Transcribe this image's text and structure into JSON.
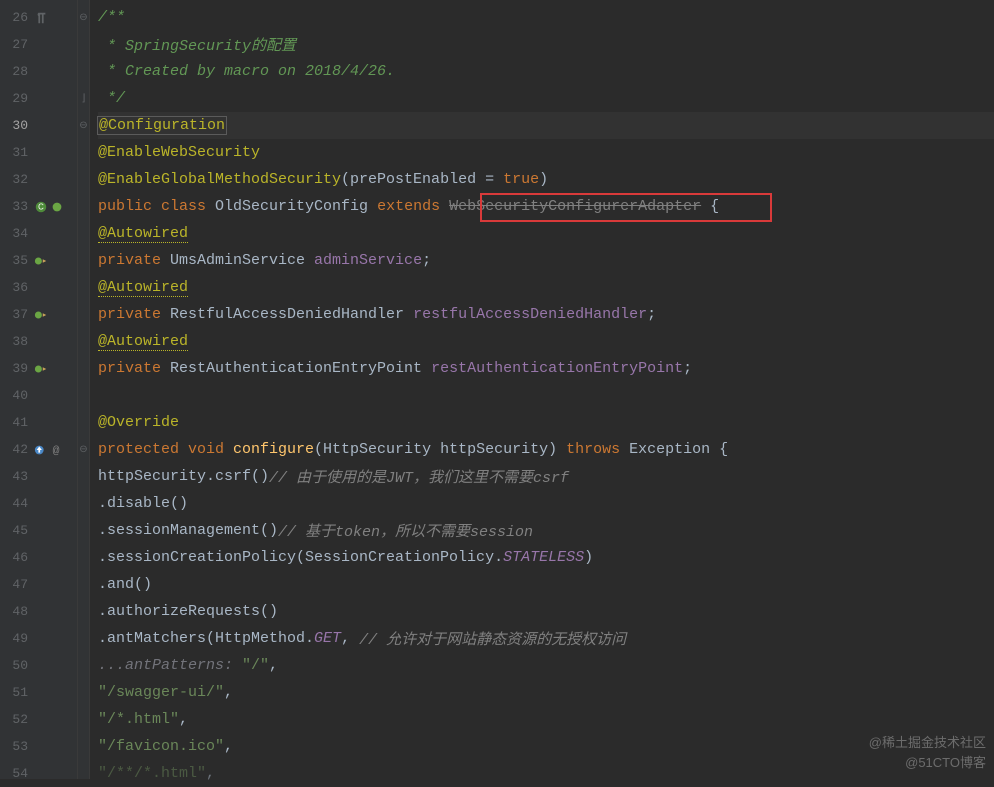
{
  "gutter": {
    "start": 26,
    "end": 54,
    "current": 30,
    "icons": {
      "26": [
        "paragraph"
      ],
      "33": [
        "class-bean"
      ],
      "35": [
        "bean-arrow"
      ],
      "37": [
        "bean-arrow"
      ],
      "39": [
        "bean-arrow"
      ],
      "42": [
        "override",
        "at"
      ]
    },
    "folds": {
      "26": "minus",
      "29": "close",
      "30": "minus",
      "42": "minus"
    }
  },
  "code": {
    "l26": {
      "doc": "/**"
    },
    "l27": {
      "doc": " * SpringSecurity的配置"
    },
    "l28": {
      "doc": " * Created by macro on 2018/4/26."
    },
    "l29": {
      "doc": " */"
    },
    "l30": {
      "annot": "@Configuration"
    },
    "l31": {
      "annot": "@EnableWebSecurity"
    },
    "l32": {
      "annot": "@EnableGlobalMethodSecurity",
      "p": "(prePostEnabled = ",
      "kw": "true",
      "p2": ")"
    },
    "l33": {
      "kw1": "public ",
      "kw2": "class ",
      "cls": "OldSecurityConfig ",
      "kw3": "extends ",
      "dep": "WebSecurityConfigurerAdapter",
      "p": " {"
    },
    "l34": {
      "annot": "@Autowired"
    },
    "l35": {
      "kw": "private ",
      "type": "UmsAdminService ",
      "field": "adminService",
      "p": ";"
    },
    "l36": {
      "annot": "@Autowired"
    },
    "l37": {
      "kw": "private ",
      "type": "RestfulAccessDeniedHandler ",
      "field": "restfulAccessDeniedHandler",
      "p": ";"
    },
    "l38": {
      "annot": "@Autowired"
    },
    "l39": {
      "kw": "private ",
      "type": "RestAuthenticationEntryPoint ",
      "field": "restAuthenticationEntryPoint",
      "p": ";"
    },
    "l41": {
      "annot": "@Override"
    },
    "l42": {
      "kw1": "protected ",
      "kw2": "void ",
      "m": "configure",
      "p1": "(HttpSecurity httpSecurity) ",
      "kw3": "throws ",
      "ex": "Exception {"
    },
    "l43": {
      "obj": "httpSecurity.csrf()",
      "cm": "// 由于使用的是JWT，我们这里不需要csrf"
    },
    "l44": {
      "m": ".disable()"
    },
    "l45": {
      "m": ".sessionManagement()",
      "cm": "// 基于token，所以不需要session"
    },
    "l46": {
      "m": ".sessionCreationPolicy(SessionCreationPolicy.",
      "s": "STATELESS",
      "p": ")"
    },
    "l47": {
      "m": ".and()"
    },
    "l48": {
      "m": ".authorizeRequests()"
    },
    "l49": {
      "m": ".antMatchers(HttpMethod.",
      "s": "GET",
      "p": ", ",
      "cm": "// 允许对于网站静态资源的无授权访问"
    },
    "l50": {
      "pn": "...antPatterns: ",
      "str": "\"/\"",
      "p": ","
    },
    "l51": {
      "str": "\"/swagger-ui/\"",
      "p": ","
    },
    "l52": {
      "str": "\"/*.html\"",
      "p": ","
    },
    "l53": {
      "str": "\"/favicon.ico\"",
      "p": ","
    },
    "l54": {
      "str": "\"/**/*.html\"",
      "p": ","
    }
  },
  "watermark": {
    "line1": "@稀土掘金技术社区",
    "line2": "@51CTO博客"
  }
}
